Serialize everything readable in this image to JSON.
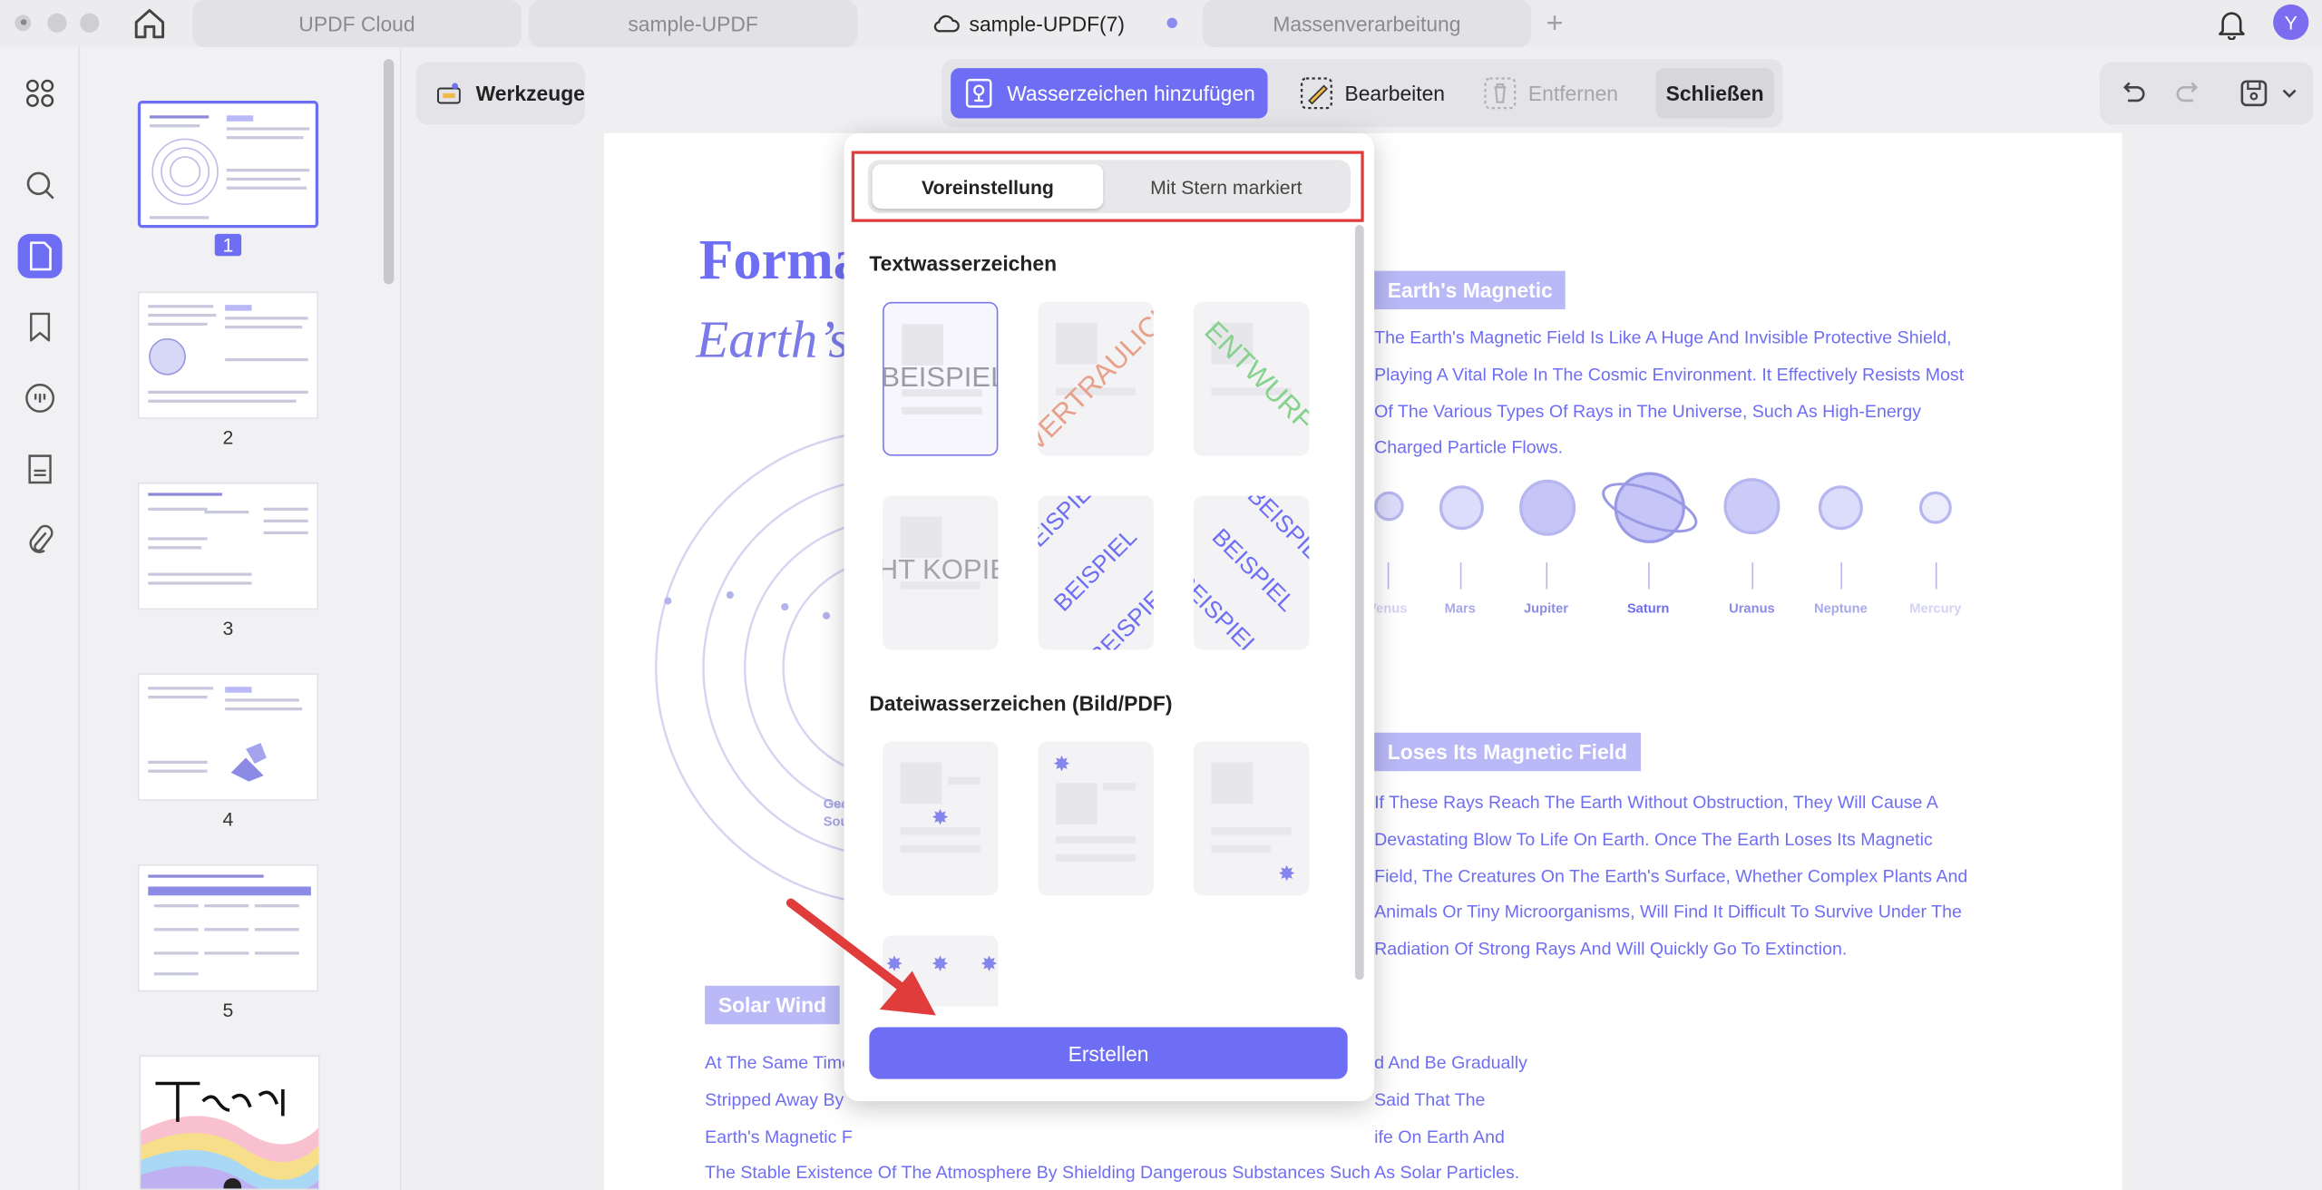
{
  "tabs": [
    {
      "label": "UPDF Cloud"
    },
    {
      "label": "sample-UPDF"
    },
    {
      "label": "sample-UPDF(7)"
    },
    {
      "label": "Massenverarbeitung"
    }
  ],
  "user": {
    "avatar_initial": "Y"
  },
  "sidebar_icons": [
    "grid-icon",
    "search-icon",
    "page-icon",
    "bookmark-icon",
    "comment-icon",
    "form-icon",
    "attachment-icon"
  ],
  "thumbnails": [
    {
      "page": "1"
    },
    {
      "page": "2"
    },
    {
      "page": "3"
    },
    {
      "page": "4"
    },
    {
      "page": "5"
    }
  ],
  "toolbar": {
    "tools_label": "Werkzeuge",
    "add_watermark_label": "Wasserzeichen hinzufügen",
    "edit_label": "Bearbeiten",
    "remove_label": "Entfernen",
    "close_label": "Schließen"
  },
  "document": {
    "title_line1": "Forma",
    "title_line2": "Earth’s",
    "section1_heading": "Earth's Magnetic",
    "section1_lines": [
      "The Earth's Magnetic Field Is Like A Huge And Invisible Protective Shield,",
      "Playing A Vital Role In The Cosmic Environment. It Effectively Resists Most",
      "Of The Various Types Of Rays in The Universe, Such As High-Energy",
      "Charged Particle Flows."
    ],
    "planets": [
      "Venus",
      "Mars",
      "Jupiter",
      "Saturn",
      "Uranus",
      "Neptune",
      "Mercury"
    ],
    "section2_heading": "Loses Its Magnetic Field",
    "section2_lines": [
      "If These Rays Reach The Earth Without Obstruction, They Will Cause A",
      "Devastating Blow To Life On Earth. Once The Earth Loses Its Magnetic",
      "Field, The Creatures On The Earth's Surface, Whether Complex Plants And",
      "Animals Or Tiny Microorganisms, Will Find It Difficult To Survive Under The",
      "Radiation Of Strong Rays And Will Quickly Go To Extinction."
    ],
    "diagram_label_1": "Geo",
    "diagram_label_2": "Sou",
    "section3_heading": "Solar Wind",
    "section3_left": [
      "At The Same Time",
      "Stripped Away By",
      "Earth's Magnetic F"
    ],
    "section3_right": [
      "d And Be Gradually",
      "Said That The",
      "ife On Earth And"
    ],
    "section3_last": "The Stable Existence Of The Atmosphere By Shielding Dangerous Substances Such As Solar Particles."
  },
  "watermark_panel": {
    "tab_preset": "Voreinstellung",
    "tab_starred": "Mit Stern markiert",
    "text_section_title": "Textwasserzeichen",
    "text_presets": [
      {
        "text": "BEISPIEL",
        "color": "#9b9ba3"
      },
      {
        "text": "VERTRAULICH",
        "color": "#e8a08a"
      },
      {
        "text": "ENTWURF",
        "color": "#86d18c"
      },
      {
        "text": "NICHT KOPIEREN",
        "color": "#a3a3aa"
      },
      {
        "text": "BEISPIEL",
        "color": "#6e6ef5"
      },
      {
        "text": "BEISPIEL",
        "color": "#6e6ef5"
      }
    ],
    "file_section_title": "Dateiwasserzeichen (Bild/PDF)",
    "create_label": "Erstellen"
  },
  "colors": {
    "accent": "#6e6ef5",
    "highlight_box": "#e03c3c"
  }
}
